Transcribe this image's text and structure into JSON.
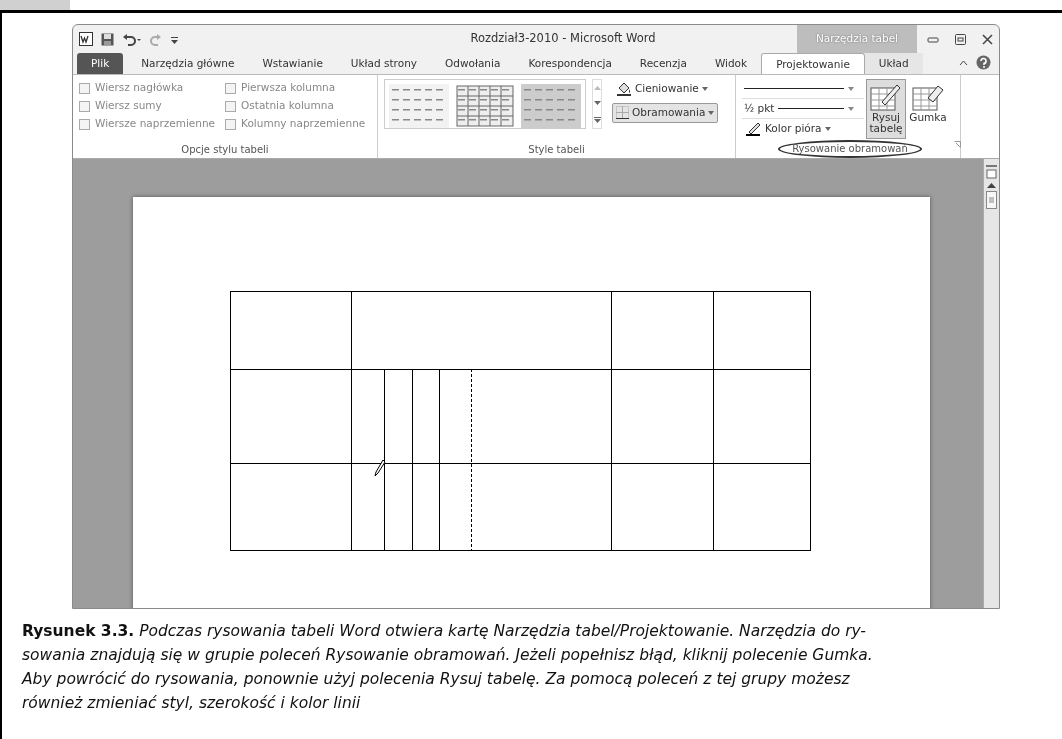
{
  "window": {
    "title": "Rozdział3-2010 - Microsoft Word",
    "context_tab_group": "Narzędzia tabel"
  },
  "tabs": [
    {
      "label": "Plik",
      "kind": "file",
      "selected": false
    },
    {
      "label": "Narzędzia główne",
      "kind": "tab",
      "selected": false
    },
    {
      "label": "Wstawianie",
      "kind": "tab",
      "selected": false
    },
    {
      "label": "Układ strony",
      "kind": "tab",
      "selected": false
    },
    {
      "label": "Odwołania",
      "kind": "tab",
      "selected": false
    },
    {
      "label": "Korespondencja",
      "kind": "tab",
      "selected": false
    },
    {
      "label": "Recenzja",
      "kind": "tab",
      "selected": false
    },
    {
      "label": "Widok",
      "kind": "tab",
      "selected": false
    },
    {
      "label": "Projektowanie",
      "kind": "context",
      "selected": true
    },
    {
      "label": "Układ",
      "kind": "context",
      "selected": false
    }
  ],
  "style_options": {
    "label": "Opcje stylu tabeli",
    "checkboxes": [
      {
        "label": "Wiersz nagłówka",
        "checked": false
      },
      {
        "label": "Wiersz sumy",
        "checked": false
      },
      {
        "label": "Wiersze naprzemienne",
        "checked": false
      },
      {
        "label": "Pierwsza kolumna",
        "checked": false
      },
      {
        "label": "Ostatnia kolumna",
        "checked": false
      },
      {
        "label": "Kolumny naprzemienne",
        "checked": false
      }
    ]
  },
  "table_styles": {
    "label": "Style tabeli",
    "shading": "Cieniowanie",
    "borders": "Obramowania"
  },
  "draw_borders": {
    "label": "Rysowanie obramowań",
    "line_weight": "½ pkt",
    "pen_color": "Kolor pióra",
    "buttons": [
      {
        "label": "Rysuj tabelę",
        "kind": "draw",
        "selected": true
      },
      {
        "label": "Gumka",
        "kind": "eraser",
        "selected": false
      }
    ]
  },
  "caption": [
    "**Rysunek 3.3.** Podczas rysowania tabeli Word otwiera kartę Narzędzia tabel/Projektowanie. Narzędzia do ry-",
    "sowania znajdują się w grupie poleceń Rysowanie obramowań. Jeżeli popełnisz błąd, kliknij polecenie Gumka.",
    "Aby powrócić do rysowania, ponownie użyj polecenia Rysuj tabelę. Za pomocą poleceń z tej grupy możesz",
    "również zmieniać styl, szerokość i kolor linii"
  ]
}
